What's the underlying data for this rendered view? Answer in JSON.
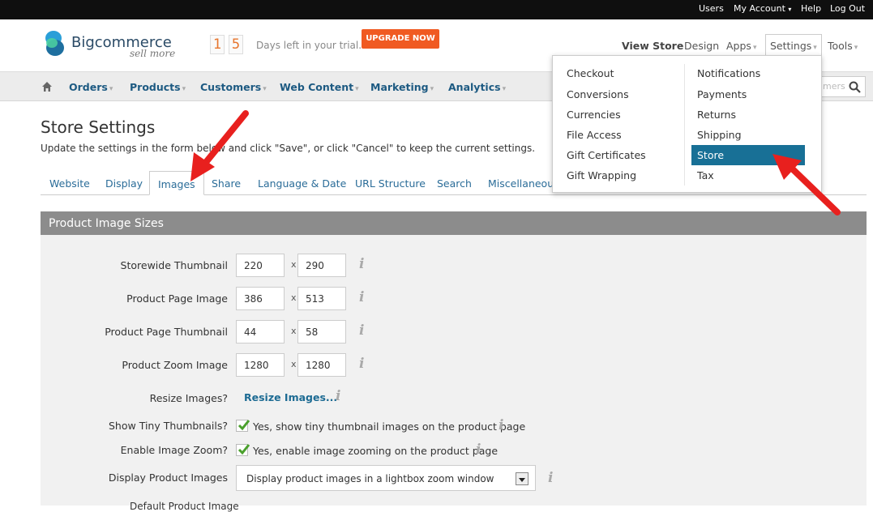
{
  "topbar": {
    "users": "Users",
    "my_account": "My Account",
    "help": "Help",
    "logout": "Log Out"
  },
  "header": {
    "logo_text": "Bigcommerce",
    "logo_tagline": "sell more",
    "trial_digits": [
      "1",
      "5"
    ],
    "trial_text": "Days left in your trial.",
    "upgrade_label": "UPGRADE NOW",
    "view_store": "View Store",
    "design": "Design",
    "apps": "Apps",
    "settings": "Settings",
    "tools": "Tools"
  },
  "mainnav": {
    "items": [
      "Orders",
      "Products",
      "Customers",
      "Web Content",
      "Marketing",
      "Analytics"
    ],
    "search_placeholder": "mers"
  },
  "settings_menu": {
    "left": [
      "Checkout",
      "Conversions",
      "Currencies",
      "File Access",
      "Gift Certificates",
      "Gift Wrapping"
    ],
    "right": [
      "Notifications",
      "Payments",
      "Returns",
      "Shipping",
      "Store",
      "Tax"
    ],
    "active": "Store"
  },
  "page": {
    "title": "Store Settings",
    "subtitle": "Update the settings in the form below and click \"Save\", or click \"Cancel\" to keep the current settings."
  },
  "tabs": [
    "Website",
    "Display",
    "Images",
    "Share",
    "Language & Date",
    "URL Structure",
    "Search",
    "Miscellaneous"
  ],
  "active_tab": "Images",
  "panel": {
    "heading": "Product Image Sizes",
    "rows": [
      {
        "label": "Storewide Thumbnail",
        "w": "220",
        "h": "290"
      },
      {
        "label": "Product Page Image",
        "w": "386",
        "h": "513"
      },
      {
        "label": "Product Page Thumbnail",
        "w": "44",
        "h": "58"
      },
      {
        "label": "Product Zoom Image",
        "w": "1280",
        "h": "1280"
      }
    ],
    "x_sep": "x",
    "info_glyph": "i",
    "resize_label": "Resize Images?",
    "resize_link": "Resize Images...",
    "tiny_label": "Show Tiny Thumbnails?",
    "tiny_text": "Yes, show tiny thumbnail images on the product page",
    "zoom_label": "Enable Image Zoom?",
    "zoom_text": "Yes, enable image zooming on the product page",
    "display_label": "Display Product Images",
    "display_value": "Display product images in a lightbox zoom window",
    "cut_label": "Default Product Image"
  },
  "colors": {
    "accent": "#187096",
    "upgrade": "#f05a22",
    "arrow": "#e8201e"
  },
  "icons": [
    "home-icon",
    "search-icon",
    "info-icon",
    "checkmark-icon",
    "dropdown-arrow-icon",
    "annotation-arrow"
  ]
}
